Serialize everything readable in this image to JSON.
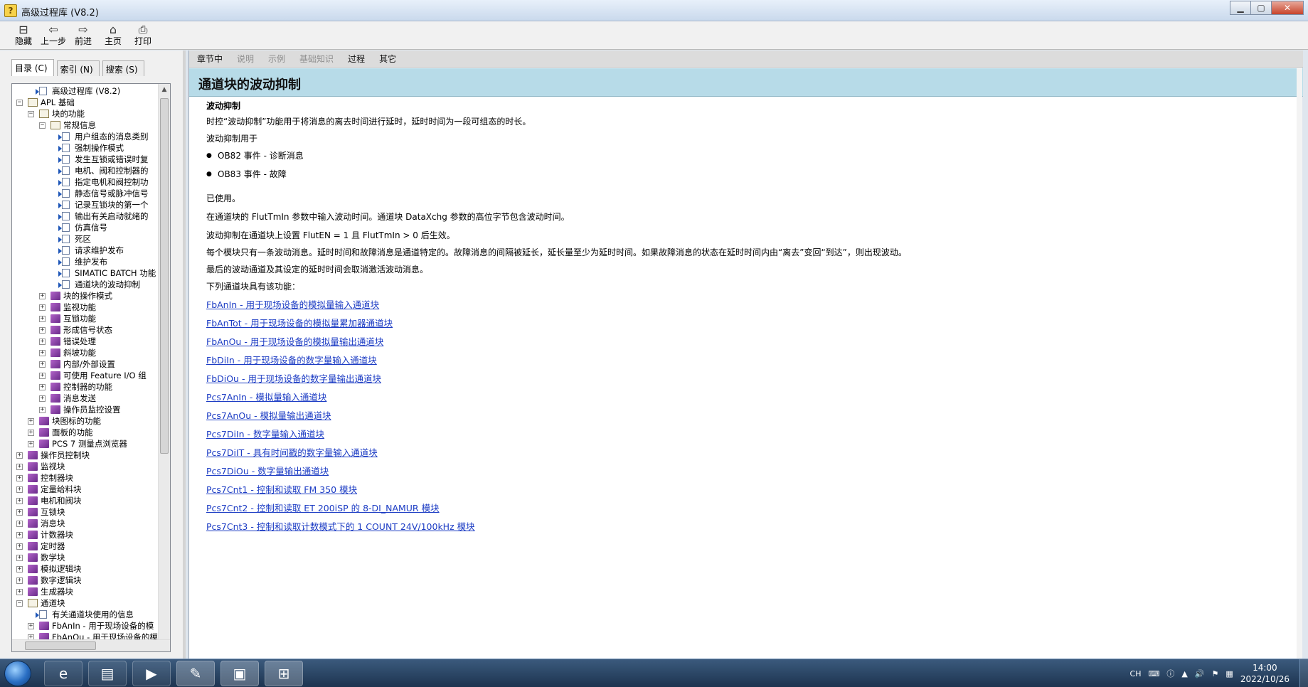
{
  "window": {
    "title": "高级过程库 (V8.2)",
    "icon": "help-icon"
  },
  "toolbar": {
    "hide_label": "隐藏",
    "back_label": "上一步",
    "forward_label": "前进",
    "home_label": "主页",
    "print_label": "打印"
  },
  "tabs": {
    "contents": "目录 (C)",
    "index": "索引 (N)",
    "search": "搜索 (S)"
  },
  "tree": [
    {
      "level": 1,
      "exp": "",
      "icon": "page",
      "text": "高级过程库 (V8.2)"
    },
    {
      "level": 0,
      "exp": "-",
      "icon": "open",
      "text": "APL 基础"
    },
    {
      "level": 1,
      "exp": "-",
      "icon": "open",
      "text": "块的功能"
    },
    {
      "level": 2,
      "exp": "-",
      "icon": "open",
      "text": "常规信息"
    },
    {
      "level": 3,
      "exp": "",
      "icon": "page",
      "text": "用户组态的消息类别"
    },
    {
      "level": 3,
      "exp": "",
      "icon": "page",
      "text": "强制操作模式"
    },
    {
      "level": 3,
      "exp": "",
      "icon": "page",
      "text": "发生互锁或错误时复"
    },
    {
      "level": 3,
      "exp": "",
      "icon": "page",
      "text": "电机、阀和控制器的"
    },
    {
      "level": 3,
      "exp": "",
      "icon": "page",
      "text": "指定电机和阀控制功"
    },
    {
      "level": 3,
      "exp": "",
      "icon": "page",
      "text": "静态信号或脉冲信号"
    },
    {
      "level": 3,
      "exp": "",
      "icon": "page",
      "text": "记录互锁块的第一个"
    },
    {
      "level": 3,
      "exp": "",
      "icon": "page",
      "text": "输出有关启动就绪的"
    },
    {
      "level": 3,
      "exp": "",
      "icon": "page",
      "text": "仿真信号"
    },
    {
      "level": 3,
      "exp": "",
      "icon": "page",
      "text": "死区"
    },
    {
      "level": 3,
      "exp": "",
      "icon": "page",
      "text": "请求维护发布"
    },
    {
      "level": 3,
      "exp": "",
      "icon": "page",
      "text": "维护发布"
    },
    {
      "level": 3,
      "exp": "",
      "icon": "page",
      "text": "SIMATIC BATCH 功能"
    },
    {
      "level": 3,
      "exp": "",
      "icon": "page",
      "text": "通道块的波动抑制"
    },
    {
      "level": 2,
      "exp": "+",
      "icon": "book",
      "text": "块的操作模式"
    },
    {
      "level": 2,
      "exp": "+",
      "icon": "book",
      "text": "监视功能"
    },
    {
      "level": 2,
      "exp": "+",
      "icon": "book",
      "text": "互锁功能"
    },
    {
      "level": 2,
      "exp": "+",
      "icon": "book",
      "text": "形成信号状态"
    },
    {
      "level": 2,
      "exp": "+",
      "icon": "book",
      "text": "错误处理"
    },
    {
      "level": 2,
      "exp": "+",
      "icon": "book",
      "text": "斜坡功能"
    },
    {
      "level": 2,
      "exp": "+",
      "icon": "book",
      "text": "内部/外部设置"
    },
    {
      "level": 2,
      "exp": "+",
      "icon": "book",
      "text": "可使用 Feature I/O 组"
    },
    {
      "level": 2,
      "exp": "+",
      "icon": "book",
      "text": "控制器的功能"
    },
    {
      "level": 2,
      "exp": "+",
      "icon": "book",
      "text": "消息发送"
    },
    {
      "level": 2,
      "exp": "+",
      "icon": "book",
      "text": "操作员监控设置"
    },
    {
      "level": 1,
      "exp": "+",
      "icon": "book",
      "text": "块图标的功能"
    },
    {
      "level": 1,
      "exp": "+",
      "icon": "book",
      "text": "面板的功能"
    },
    {
      "level": 1,
      "exp": "+",
      "icon": "book",
      "text": "PCS 7 测量点浏览器"
    },
    {
      "level": 0,
      "exp": "+",
      "icon": "book",
      "text": "操作员控制块"
    },
    {
      "level": 0,
      "exp": "+",
      "icon": "book",
      "text": "监视块"
    },
    {
      "level": 0,
      "exp": "+",
      "icon": "book",
      "text": "控制器块"
    },
    {
      "level": 0,
      "exp": "+",
      "icon": "book",
      "text": "定量给料块"
    },
    {
      "level": 0,
      "exp": "+",
      "icon": "book",
      "text": "电机和阀块"
    },
    {
      "level": 0,
      "exp": "+",
      "icon": "book",
      "text": "互锁块"
    },
    {
      "level": 0,
      "exp": "+",
      "icon": "book",
      "text": "消息块"
    },
    {
      "level": 0,
      "exp": "+",
      "icon": "book",
      "text": "计数器块"
    },
    {
      "level": 0,
      "exp": "+",
      "icon": "book",
      "text": "定时器"
    },
    {
      "level": 0,
      "exp": "+",
      "icon": "book",
      "text": "数学块"
    },
    {
      "level": 0,
      "exp": "+",
      "icon": "book",
      "text": "模拟逻辑块"
    },
    {
      "level": 0,
      "exp": "+",
      "icon": "book",
      "text": "数字逻辑块"
    },
    {
      "level": 0,
      "exp": "+",
      "icon": "book",
      "text": "生成器块"
    },
    {
      "level": 0,
      "exp": "-",
      "icon": "open",
      "text": "通道块"
    },
    {
      "level": 1,
      "exp": "",
      "icon": "page",
      "text": "有关通道块使用的信息"
    },
    {
      "level": 1,
      "exp": "+",
      "icon": "book",
      "text": "FbAnIn - 用于现场设备的模"
    },
    {
      "level": 1,
      "exp": "+",
      "icon": "book",
      "text": "FbAnOu - 用于现场设备的模"
    }
  ],
  "nav": {
    "in_chapter": "章节中",
    "description": "说明",
    "examples": "示例",
    "basics": "基础知识",
    "procedure": "过程",
    "other": "其它"
  },
  "page": {
    "heading": "通道块的波动抑制",
    "section_title": "波动抑制",
    "intro": "时控“波动抑制”功能用于将消息的离去时间进行延时，延时时间为一段可组态的时长。",
    "used_for": "波动抑制用于",
    "bullets": [
      "OB82 事件 - 诊断消息",
      "OB83 事件 - 故障"
    ],
    "used": "已使用。",
    "para1": "在通道块的 FlutTmIn 参数中输入波动时间。通道块 DataXchg 参数的高位字节包含波动时间。",
    "para2": "波动抑制在通道块上设置 FlutEN = 1 且 FlutTmIn > 0 后生效。",
    "para3": "每个模块只有一条波动消息。延时时间和故障消息是通道特定的。故障消息的间隔被延长，延长量至少为延时时间。如果故障消息的状态在延时时间内由“离去”变回“到达”，则出现波动。",
    "para4": "最后的波动通道及其设定的延时时间会取消激活波动消息。",
    "para5": "下列通道块具有该功能：",
    "links": [
      "FbAnIn - 用于现场设备的模拟量输入通道块",
      "FbAnTot - 用于现场设备的模拟量累加器通道块",
      "FbAnOu - 用于现场设备的模拟量输出通道块",
      "FbDiIn - 用于现场设备的数字量输入通道块",
      "FbDiOu - 用于现场设备的数字量输出通道块",
      "Pcs7AnIn - 模拟量输入通道块",
      "Pcs7AnOu - 模拟量输出通道块",
      "Pcs7DiIn - 数字量输入通道块",
      "Pcs7DiIT - 具有时间戳的数字量输入通道块",
      "Pcs7DiOu - 数字量输出通道块",
      "Pcs7Cnt1 - 控制和读取 FM 350 模块",
      "Pcs7Cnt2 - 控制和读取 ET 200iSP 的 8-DI_NAMUR 模块",
      "Pcs7Cnt3 - 控制和读取计数模式下的 1 COUNT 24V/100kHz 模块"
    ]
  },
  "taskbar": {
    "lang": "CH",
    "time": "14:00",
    "date": "2022/10/26"
  }
}
